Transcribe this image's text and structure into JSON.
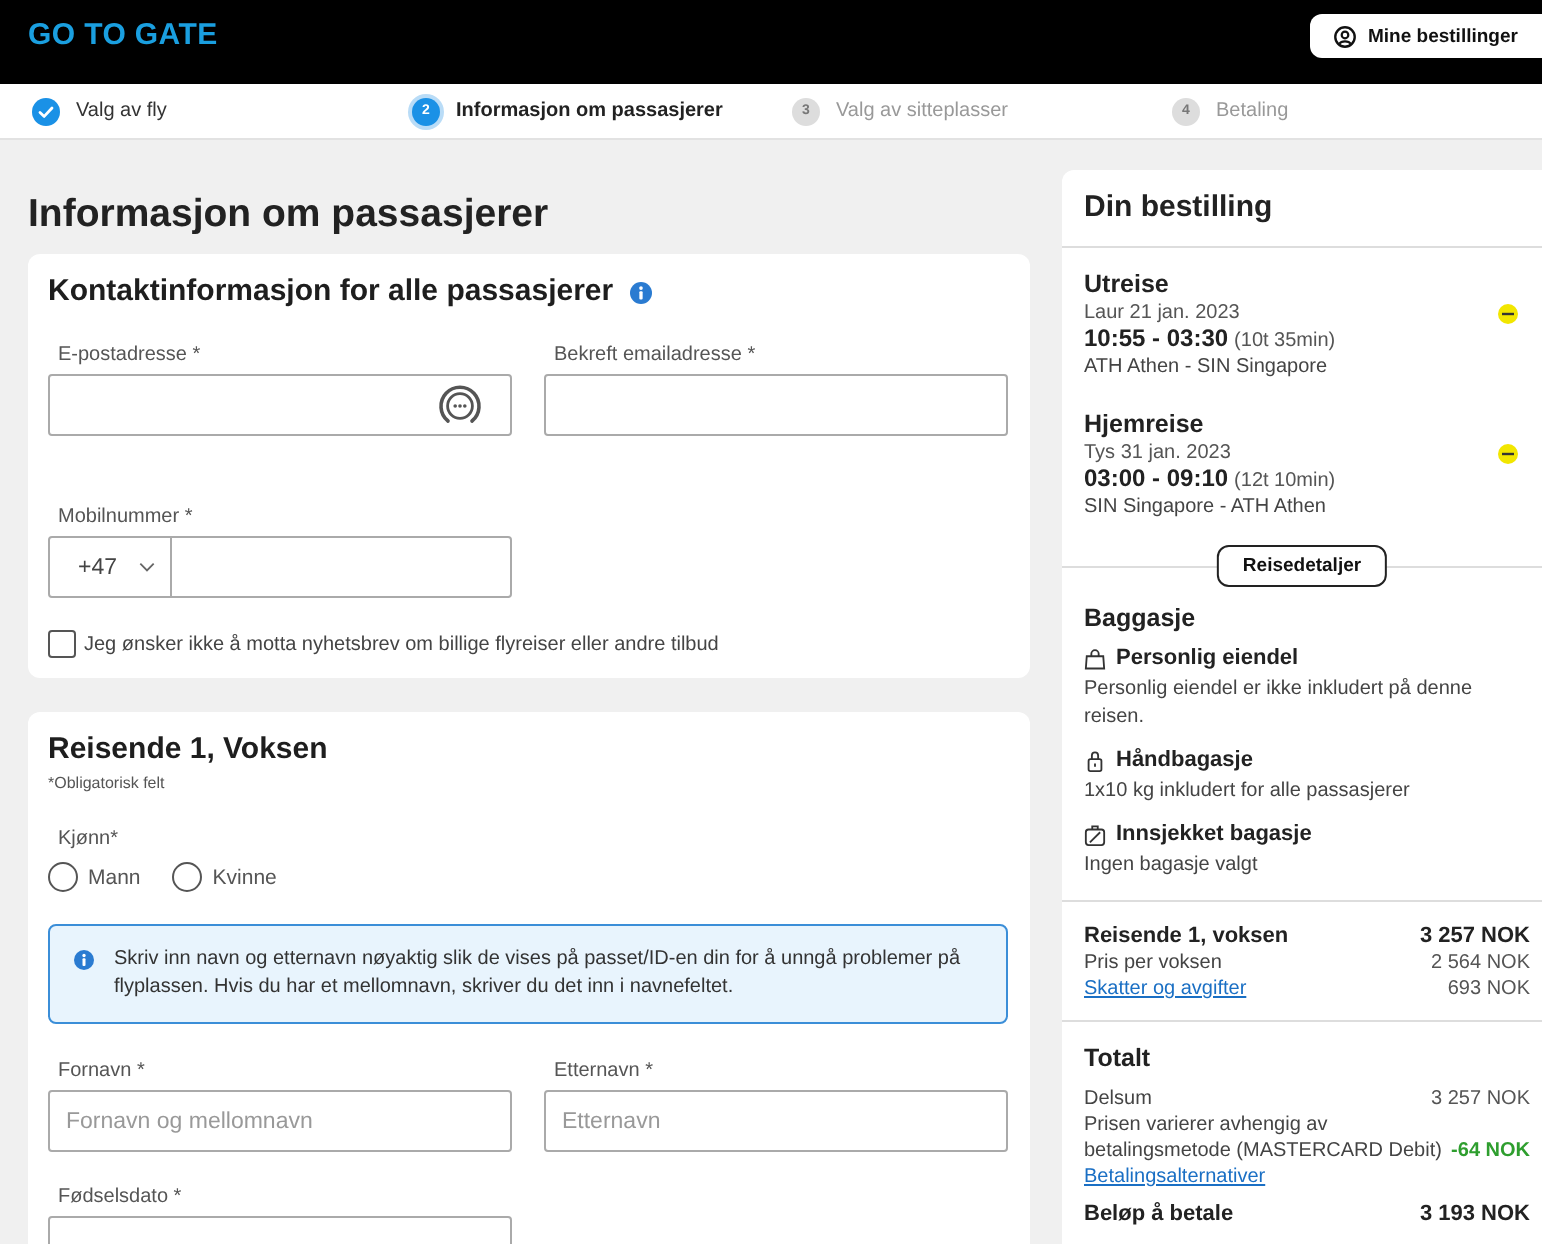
{
  "header": {
    "logo": "GO TO GATE",
    "account_button": "Mine bestillinger"
  },
  "steps": [
    {
      "label": "Valg av fly",
      "completed": true,
      "selected": false
    },
    {
      "number": "2",
      "label": "Informasjon om passasjerer",
      "completed": false,
      "selected": true
    },
    {
      "number": "3",
      "label": "Valg av sitteplasser",
      "completed": false,
      "selected": false
    },
    {
      "number": "4",
      "label": "Betaling",
      "completed": false,
      "selected": false
    }
  ],
  "page_title": "Informasjon om passasjerer",
  "contact": {
    "title": "Kontaktinformasjon for alle passasjerer",
    "fields": [
      {
        "kind": "email",
        "label": "E-postadresse *"
      },
      {
        "kind": "text",
        "label": "Bekreft emailadresse *"
      },
      {
        "kind": "phone",
        "label": "Mobilnummer *",
        "country_code": "+47"
      }
    ],
    "newsletter_opt_out": {
      "label": "Jeg ønsker ikke å motta nyhetsbrev om billige flyreiser eller andre tilbud",
      "checked": false
    }
  },
  "traveler": {
    "title": "Reisende 1, Voksen",
    "required_note": "*Obligatorisk felt",
    "gender": {
      "label": "Kjønn*",
      "options": [
        {
          "label": "Mann",
          "selected": false
        },
        {
          "label": "Kvinne",
          "selected": false
        }
      ]
    },
    "notice": "Skriv inn navn og etternavn nøyaktig slik de vises på passet/ID-en din for å unngå problemer på flyplassen. Hvis du har et mellomnavn, skriver du det inn i navnefeltet.",
    "fields": [
      {
        "kind": "text",
        "label": "Fornavn *",
        "placeholder": "Fornavn og mellomnavn"
      },
      {
        "kind": "text",
        "label": "Etternavn *",
        "placeholder": "Etternavn"
      },
      {
        "kind": "text",
        "label": "Fødselsdato *"
      }
    ]
  },
  "summary": {
    "title": "Din bestilling",
    "trips": [
      {
        "title": "Utreise",
        "date": "Laur 21 jan. 2023",
        "times": "10:55 - 03:30",
        "duration": "(10t 35min)",
        "route": "ATH Athen - SIN Singapore"
      },
      {
        "title": "Hjemreise",
        "date": "Tys 31 jan. 2023",
        "times": "03:00 - 09:10",
        "duration": "(12t 10min)",
        "route": "SIN Singapore - ATH Athen"
      }
    ],
    "details_button": "Reisedetaljer",
    "baggage": {
      "title": "Baggasje",
      "items": [
        {
          "kind": "personal",
          "title": "Personlig eiendel",
          "description": "Personlig eiendel er ikke inkludert på denne reisen."
        },
        {
          "kind": "cabin",
          "title": "Håndbagasje",
          "description": "1x10 kg inkludert for alle passasjerer"
        },
        {
          "kind": "checked",
          "title": "Innsjekket bagasje",
          "description": "Ingen bagasje valgt"
        }
      ]
    },
    "traveler_price": [
      {
        "kind": "heading",
        "label": "Reisende 1, voksen",
        "amount": "3 257 NOK"
      },
      {
        "kind": "plain",
        "label": "Pris per voksen",
        "amount": "2 564 NOK"
      },
      {
        "kind": "link",
        "label": "Skatter og avgifter",
        "amount": "693 NOK"
      }
    ],
    "total": {
      "title": "Totalt",
      "rows": [
        {
          "kind": "plain",
          "label": "Delsum",
          "amount": "3 257 NOK"
        },
        {
          "kind": "discount",
          "label": "Prisen varierer avhengig av betalingsmetode (MASTERCARD Debit)",
          "amount": "-64 NOK"
        },
        {
          "kind": "link",
          "label": "Betalingsalternativer"
        },
        {
          "kind": "heading",
          "label": "Beløp å betale",
          "amount": "3 193 NOK"
        }
      ]
    }
  }
}
